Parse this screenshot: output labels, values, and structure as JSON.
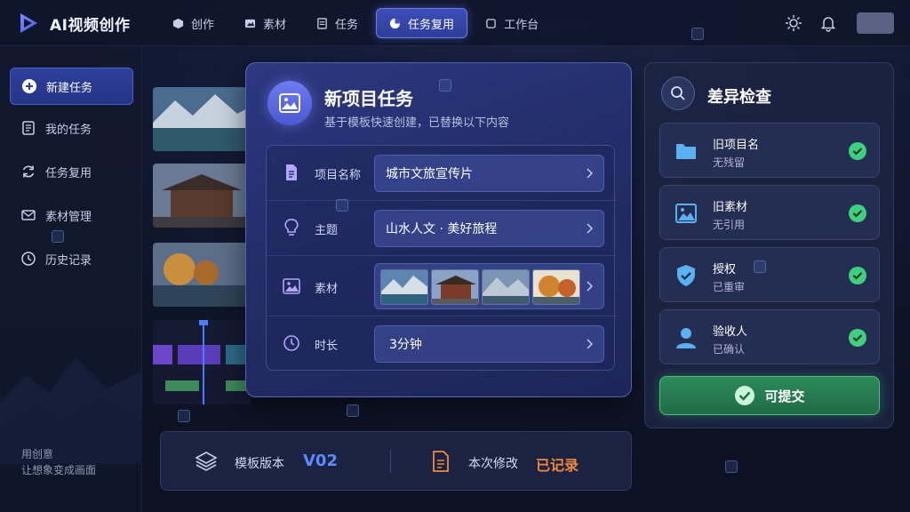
{
  "app": {
    "name": "AI视频创作"
  },
  "nav": [
    {
      "label": "创作",
      "icon": "cube-icon"
    },
    {
      "label": "素材",
      "icon": "image-icon"
    },
    {
      "label": "任务",
      "icon": "checklist-icon"
    },
    {
      "label": "任务复用",
      "icon": "pie-icon",
      "active": true
    },
    {
      "label": "工作台",
      "icon": "square-icon"
    }
  ],
  "sidebar": {
    "items": [
      {
        "label": "新建任务",
        "icon": "plus-circle-icon",
        "active": true
      },
      {
        "label": "我的任务",
        "icon": "document-icon"
      },
      {
        "label": "任务复用",
        "icon": "refresh-icon"
      },
      {
        "label": "素材管理",
        "icon": "mail-icon"
      },
      {
        "label": "历史记录",
        "icon": "clock-icon"
      }
    ],
    "slogan_line1": "用创意",
    "slogan_line2": "让想象变成画面"
  },
  "modal": {
    "title": "新项目任务",
    "subtitle": "基于模板快速创建，已替换以下内容",
    "rows": [
      {
        "label": "项目名称",
        "value": "城市文旅宣传片",
        "icon": "file-icon"
      },
      {
        "label": "主题",
        "value": "山水人文 · 美好旅程",
        "icon": "bulb-icon"
      },
      {
        "label": "素材",
        "value": "",
        "icon": "image-icon"
      },
      {
        "label": "时长",
        "value": "3分钟",
        "icon": "clock-icon"
      }
    ]
  },
  "bottom": {
    "version_label": "模板版本",
    "version_value": "V02",
    "change_label": "本次修改",
    "change_value": "已记录"
  },
  "diff": {
    "title": "差异检查",
    "items": [
      {
        "title": "旧项目名",
        "sub": "无残留",
        "icon": "folder-icon"
      },
      {
        "title": "旧素材",
        "sub": "无引用",
        "icon": "picture-icon"
      },
      {
        "title": "授权",
        "sub": "已重审",
        "icon": "shield-check-icon"
      },
      {
        "title": "验收人",
        "sub": "已确认",
        "icon": "person-icon"
      }
    ],
    "submit": "可提交"
  },
  "colors": {
    "accent": "#4b5fcc",
    "success": "#3fcf7e",
    "orange": "#f08a3c",
    "version_blue": "#5b8cff"
  }
}
